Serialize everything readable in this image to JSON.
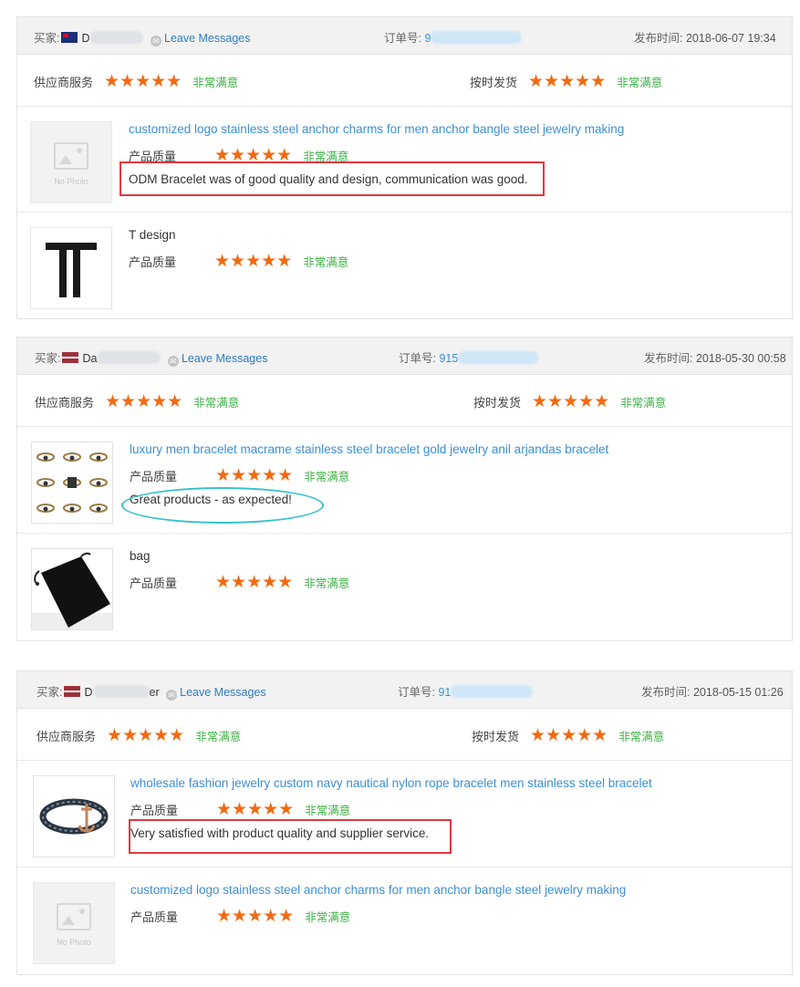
{
  "colors": {
    "star": "#f26a10",
    "satisfied": "#3cb043",
    "link": "#3d8fd6",
    "highlight_box": "#e0393e",
    "highlight_oval": "#35c2cc"
  },
  "labels": {
    "buyer": "买家:",
    "leave_messages": "Leave Messages",
    "order_no": "订单号:",
    "publish_time": "发布时间:",
    "supplier_service": "供应商服务",
    "on_time": "按时发货",
    "product_quality": "产品质量",
    "very_satisfied": "非常满意",
    "stars": "★★★★★",
    "no_photo": "No Photo"
  },
  "reviews": [
    {
      "buyer_prefix": "D",
      "buyer_flag": "australia",
      "order_prefix": "9",
      "time": "2018-06-07 19:34",
      "supplier_service_rating": 5,
      "on_time_rating": 5,
      "products": [
        {
          "title": "customized logo stainless steel anchor charms for men anchor bangle steel jewelry making",
          "image": "no-photo",
          "rating": 5,
          "comment": "ODM Bracelet was of good quality and design, communication was good."
        },
        {
          "title": "T design",
          "image": "t-logo",
          "rating": 5,
          "comment": ""
        }
      ]
    },
    {
      "buyer_prefix": "Da",
      "buyer_flag": "latvia",
      "order_prefix": "915",
      "time": "2018-05-30 00:58",
      "supplier_service_rating": 5,
      "on_time_rating": 5,
      "products": [
        {
          "title": "luxury men bracelet macrame stainless steel bracelet gold jewelry anil arjandas bracelet",
          "image": "bracelet-grid",
          "rating": 5,
          "comment": "Great products - as expected!"
        },
        {
          "title": "bag",
          "image": "black-pouch",
          "rating": 5,
          "comment": ""
        }
      ]
    },
    {
      "buyer_prefix": "D",
      "buyer_suffix": "er",
      "buyer_flag": "latvia",
      "order_prefix": "91",
      "time": "2018-05-15 01:26",
      "supplier_service_rating": 5,
      "on_time_rating": 5,
      "products": [
        {
          "title": "wholesale fashion jewelry custom navy nautical nylon rope bracelet men stainless steel bracelet",
          "image": "rope-anchor-bracelet",
          "rating": 5,
          "comment": "Very satisfied with product quality and supplier service."
        },
        {
          "title": "customized logo stainless steel anchor charms for men anchor bangle steel jewelry making",
          "image": "no-photo",
          "rating": 5,
          "comment": ""
        }
      ]
    }
  ]
}
